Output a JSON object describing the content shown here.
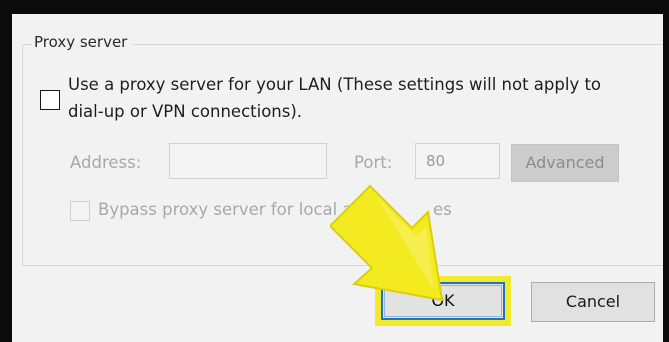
{
  "group": {
    "title": "Proxy server"
  },
  "proxy": {
    "checkbox_label_line1": "Use a proxy server for your LAN (These settings will not apply to",
    "checkbox_label_line2": "dial-up or VPN connections).",
    "checked": false
  },
  "address": {
    "label": "Address:",
    "value": ""
  },
  "port": {
    "label": "Port:",
    "value": "80"
  },
  "advanced_button": {
    "label": "Advanced"
  },
  "bypass": {
    "label": "Bypass proxy server for local a",
    "label_tail": "es",
    "checked": false
  },
  "footer": {
    "ok_label": "OK",
    "cancel_label": "Cancel"
  },
  "colors": {
    "highlight": "#f2ea2c",
    "ok_border": "#1f72c8",
    "dialog_bg": "#f2f2f2"
  },
  "icons": {
    "pointer": "arrow-pointer-icon"
  }
}
